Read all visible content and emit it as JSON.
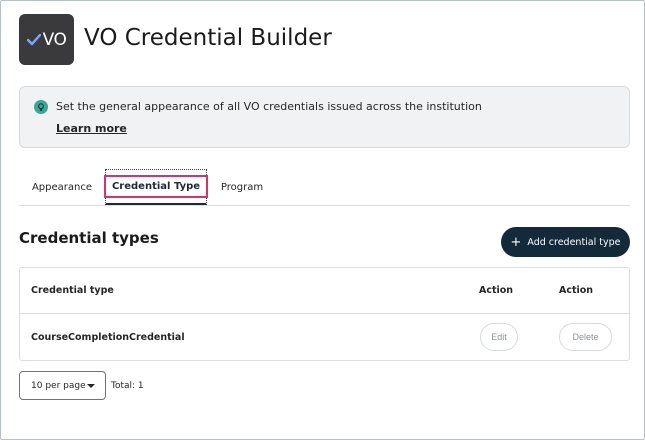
{
  "header": {
    "logo_text": "VO",
    "title": "VO Credential Builder"
  },
  "banner": {
    "text": "Set the general appearance of all VO credentials issued across the institution",
    "link": "Learn more"
  },
  "tabs": [
    {
      "label": "Appearance",
      "selected": false
    },
    {
      "label": "Credential Type",
      "selected": true
    },
    {
      "label": "Program",
      "selected": false
    }
  ],
  "section": {
    "title": "Credential types",
    "add_button": "Add credential type"
  },
  "table": {
    "columns": [
      "Credential type",
      "Action",
      "Action"
    ],
    "rows": [
      {
        "type": "CourseCompletionCredential",
        "edit": "Edit",
        "delete": "Delete"
      }
    ]
  },
  "pagination": {
    "per_page": "10 per page",
    "total": "Total: 1"
  },
  "colors": {
    "accent_dark": "#122a3a",
    "tab_focus_outline": "#d6336c",
    "banner_icon": "#39a89a",
    "logo_bg": "#3a3a3c"
  }
}
